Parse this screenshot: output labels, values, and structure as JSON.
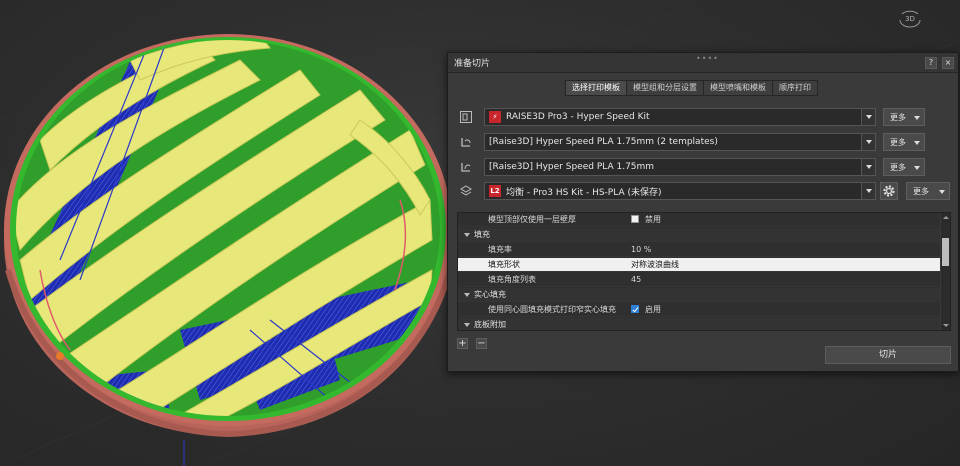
{
  "viewport": {
    "view_cube_label": "3D"
  },
  "dialog": {
    "title": "准备切片",
    "help_label": "?",
    "close_label": "×",
    "tabs": [
      {
        "label": "选择打印模板",
        "active": true
      },
      {
        "label": "模型组和分层设置",
        "active": false
      },
      {
        "label": "模型喷嘴和模板",
        "active": false
      },
      {
        "label": "顺序打印",
        "active": false
      }
    ],
    "profiles": [
      {
        "icon": "printer-icon",
        "badge": "⚡",
        "value": "RAISE3D Pro3 - Hyper Speed Kit",
        "more": "更多"
      },
      {
        "icon": "left-extruder-icon",
        "badge": "",
        "value": "[Raise3D] Hyper Speed PLA 1.75mm (2 templates)",
        "more": "更多"
      },
      {
        "icon": "right-extruder-icon",
        "badge": "",
        "value": "[Raise3D] Hyper Speed PLA 1.75mm",
        "more": "更多"
      },
      {
        "icon": "layers-icon",
        "badge": "L2",
        "value": "均衡 - Pro3 HS Kit - HS-PLA (未保存)",
        "more": "更多"
      }
    ],
    "settings": [
      {
        "type": "item",
        "label": "模型顶部仅使用一层壁厚",
        "checkbox": "off",
        "value": "禁用"
      },
      {
        "type": "section",
        "label": "填充"
      },
      {
        "type": "item",
        "label": "填充率",
        "value": "10 %"
      },
      {
        "type": "item",
        "label": "填充形状",
        "value": "对称波浪曲线",
        "selected": true
      },
      {
        "type": "item",
        "label": "填充角度列表",
        "value": "45"
      },
      {
        "type": "section",
        "label": "实心填充"
      },
      {
        "type": "item",
        "label": "使用同心圆填充模式打印窄实心填充",
        "checkbox": "on",
        "value": "启用"
      },
      {
        "type": "section",
        "label": "底板附加"
      }
    ],
    "add_label": "+",
    "remove_label": "−",
    "slice_label": "切片"
  },
  "colors": {
    "accent": "#2f7fd6",
    "infill_yellow": "#e8e87a",
    "wall_green": "#33b82e",
    "outer_red": "#c56a5f",
    "support_blue": "#1d2cb0",
    "badge_red": "#c8262d"
  }
}
